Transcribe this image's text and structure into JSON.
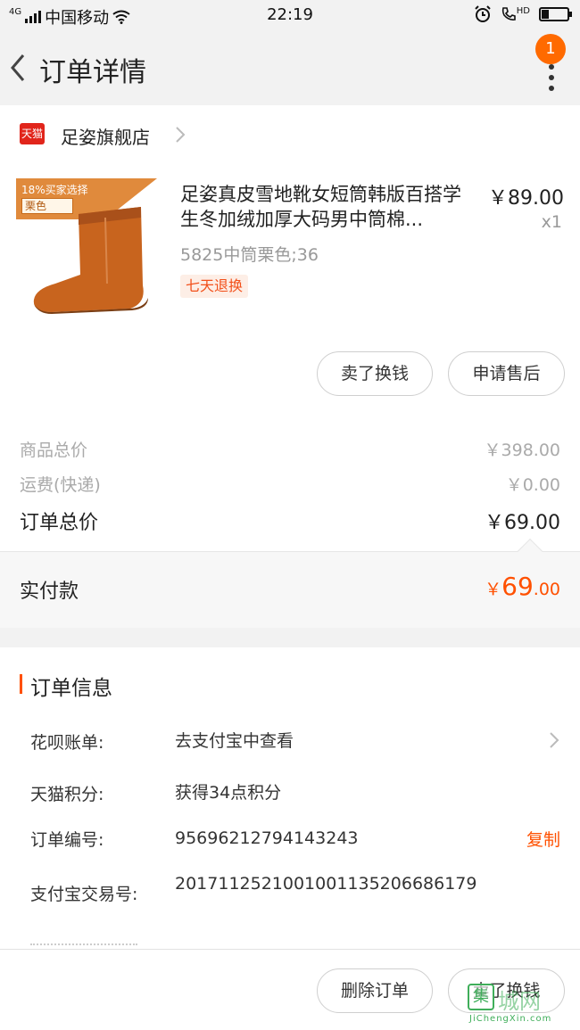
{
  "status_bar": {
    "network_type": "4G",
    "carrier": "中国移动",
    "time": "22:19",
    "hd_label": "HD",
    "icons": [
      "signal-icon",
      "wifi-icon",
      "alarm-icon",
      "call-hd-icon",
      "battery-icon"
    ],
    "battery_level": 0.3
  },
  "nav": {
    "title": "订单详情",
    "badge_count": "1"
  },
  "shop": {
    "platform_logo": "天猫",
    "name": "足姿旗舰店"
  },
  "product": {
    "image_promo": "18%买家选择",
    "image_color": "栗色",
    "name": "足姿真皮雪地靴女短筒韩版百搭学生冬加绒加厚大码男中筒棉...",
    "price": "￥89.00",
    "quantity": "x1",
    "spec": "5825中筒栗色;36",
    "tag": "七天退换",
    "boot_color": "#c8641e"
  },
  "actions": {
    "sell": "卖了换钱",
    "after_sale": "申请售后"
  },
  "summary": {
    "goods_total_label": "商品总价",
    "goods_total": "￥398.00",
    "shipping_label": "运费(快递)",
    "shipping": "￥0.00",
    "order_total_label": "订单总价",
    "order_total": "￥69.00"
  },
  "paid": {
    "label": "实付款",
    "currency": "￥",
    "integer": "69",
    "decimal": ".00",
    "accent_color": "#ff5000"
  },
  "order_info": {
    "title": "订单信息",
    "rows": [
      {
        "label": "花呗账单:",
        "value": "去支付宝中查看"
      },
      {
        "label": "天猫积分:",
        "value": "获得34点积分"
      },
      {
        "label": "订单编号:",
        "value": "95696212794143243",
        "action": "复制"
      },
      {
        "label": "支付宝交易号:",
        "value": "2017112521001001135206686179"
      }
    ]
  },
  "bottom": {
    "delete": "删除订单",
    "sell": "卖了换钱"
  },
  "watermark": {
    "logo": "集",
    "text": "城网",
    "url": "JiChengXin.com"
  }
}
